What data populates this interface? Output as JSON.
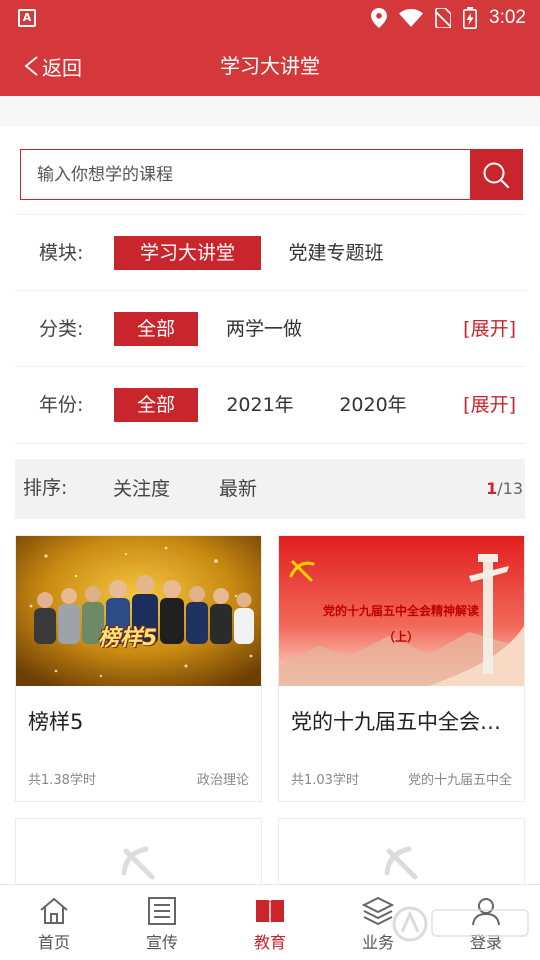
{
  "status_bar": {
    "time": "3:02",
    "icons": [
      "app-notification-icon",
      "location-icon",
      "wifi-icon",
      "no-sim-icon",
      "battery-icon"
    ]
  },
  "header": {
    "back_label": "返回",
    "title": "学习大讲堂"
  },
  "search": {
    "placeholder": "输入你想学的课程"
  },
  "filters": {
    "module": {
      "label": "模块:",
      "options": [
        "学习大讲堂",
        "党建专题班"
      ],
      "selected": "学习大讲堂"
    },
    "category": {
      "label": "分类:",
      "options": [
        "全部",
        "两学一做"
      ],
      "selected": "全部",
      "expand": "[展开]"
    },
    "year": {
      "label": "年份:",
      "options": [
        "全部",
        "2021年",
        "2020年"
      ],
      "selected": "全部",
      "expand": "[展开]"
    }
  },
  "sort": {
    "label": "排序:",
    "options": [
      "关注度",
      "最新"
    ],
    "page_current": "1",
    "page_separator": "/",
    "page_total": "13"
  },
  "courses": [
    {
      "title": "榜样5",
      "hours": "共1.38学时",
      "category": "政治理论",
      "thumb_caption": "榜样5"
    },
    {
      "title": "党的十九届五中全会精神解读（上）",
      "hours": "共1.03学时",
      "category": "党的十九届五中全",
      "thumb_caption": "党的十九届五中全会精神解读",
      "thumb_caption_2": "（上）"
    }
  ],
  "bottom_nav": [
    {
      "label": "首页",
      "icon": "home-icon"
    },
    {
      "label": "宣传",
      "icon": "news-icon"
    },
    {
      "label": "教育",
      "icon": "book-icon",
      "active": true
    },
    {
      "label": "业务",
      "icon": "layers-icon"
    },
    {
      "label": "登录",
      "icon": "user-icon"
    }
  ],
  "colors": {
    "brand_red": "#d4383a",
    "accent_red": "#c9252c",
    "text": "#333333",
    "muted": "#888888"
  }
}
